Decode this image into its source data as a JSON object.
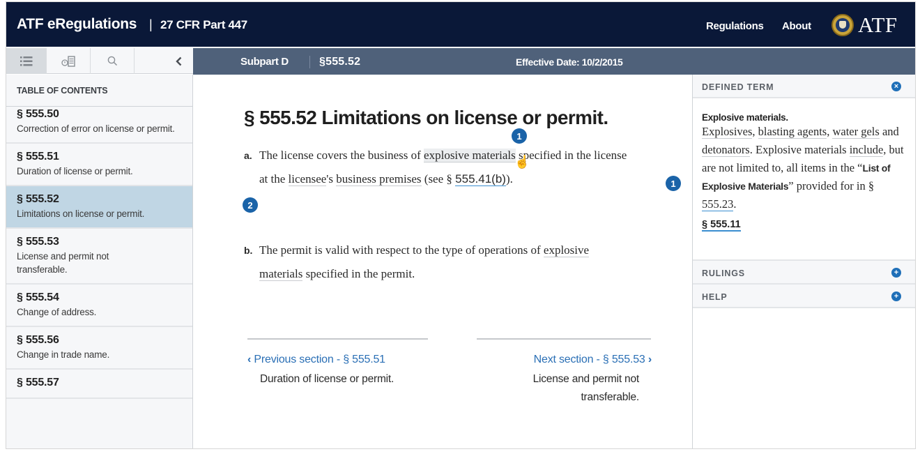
{
  "header": {
    "brand": "ATF eRegulations",
    "separator": "|",
    "part": "27 CFR Part 447",
    "nav": [
      {
        "label": "Regulations"
      },
      {
        "label": "About"
      }
    ],
    "logo_text": "ATF",
    "logo_icon": "atf-seal-icon"
  },
  "sidebar_tools": [
    {
      "icon": "list-icon",
      "glyph": "☰",
      "active": true
    },
    {
      "icon": "history-icon",
      "glyph": "◷▤"
    },
    {
      "icon": "search-icon",
      "glyph": "⚲"
    },
    {
      "icon": "collapse-chevron-icon",
      "glyph": "‹"
    }
  ],
  "section_bar": {
    "subpart": "Subpart D",
    "section": "§555.52",
    "effective_date": "Effective Date: 10/2/2015"
  },
  "toc": {
    "heading": "TABLE OF CONTENTS",
    "items": [
      {
        "num": "§ 555.50",
        "title": "Correction of error on license or permit."
      },
      {
        "num": "§ 555.51",
        "title": "Duration of license or permit."
      },
      {
        "num": "§ 555.52",
        "title": "Limitations on license or permit.",
        "active": true
      },
      {
        "num": "§ 555.53",
        "title": "License and permit not transferable."
      },
      {
        "num": "§ 555.54",
        "title": "Change of address."
      },
      {
        "num": "§ 555.56",
        "title": "Change in trade name."
      },
      {
        "num": "§ 555.57",
        "title": ""
      }
    ]
  },
  "content": {
    "heading": "§ 555.52 Limitations on license or permit.",
    "paragraph_a": {
      "label": "a.",
      "t1": "The license covers the business of ",
      "term1": "explosive materials",
      "t2": " specified in the license at the ",
      "term2": "licensee",
      "t3": "'s ",
      "term3": "business premises",
      "t4": " (see § ",
      "cite": "555.41(b)",
      "t5": ")."
    },
    "paragraph_b": {
      "label": "b.",
      "t1": "The permit is valid with respect to the type of operations of ",
      "term1": "explosive materials",
      "t2": " specified in the permit."
    },
    "badges": [
      "1",
      "2",
      "1"
    ],
    "prev": {
      "label": "Previous section - § 555.51",
      "chevron": "‹",
      "title": "Duration of license or permit."
    },
    "next": {
      "label": "Next section - § 555.53",
      "chevron": "›",
      "title": "License and permit not transferable."
    }
  },
  "drawer": {
    "defined_term": {
      "header": "DEFINED TERM",
      "close_glyph": "×",
      "term": "Explosive materials.",
      "d_term1": "Explosives",
      "d_t1": ", ",
      "d_term2": "blasting agents",
      "d_t2": ", ",
      "d_term3": "water gels",
      "d_t3": " and ",
      "d_term4": "detonators",
      "d_t4": ". Explosive materials ",
      "d_term5": "include",
      "d_t5": ", but are not limited to, all items in the “",
      "d_bold": "List of Explosive Materials",
      "d_t6": "” provided for in § ",
      "d_cite": "555.23",
      "d_t7": ".",
      "source": "§ 555.11"
    },
    "rows": [
      {
        "label": "RULINGS",
        "glyph": "+"
      },
      {
        "label": "HELP",
        "glyph": "+"
      }
    ]
  }
}
